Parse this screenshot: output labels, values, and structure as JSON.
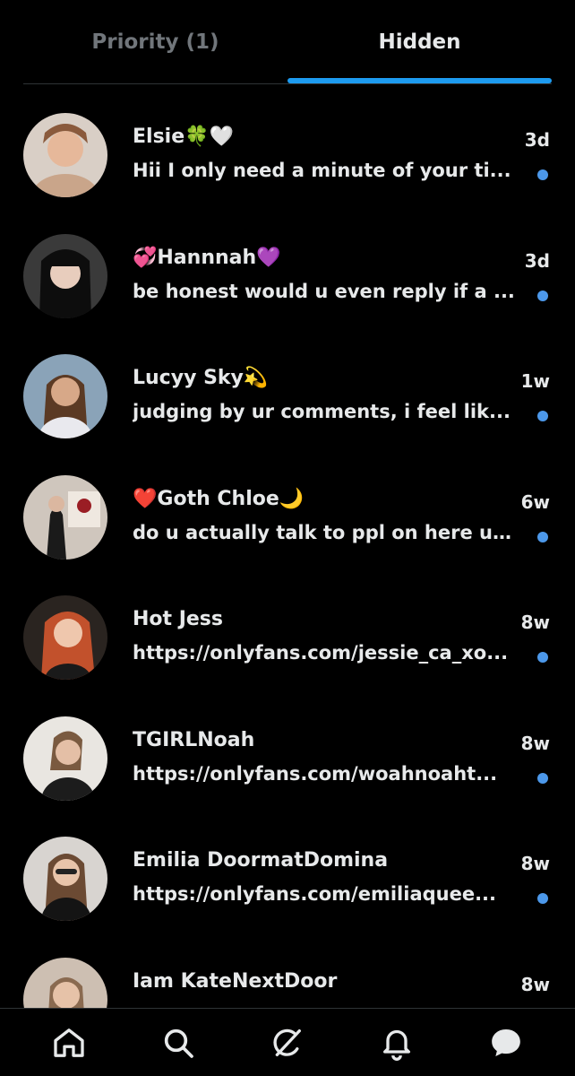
{
  "tabs": [
    {
      "label": "Priority (1)",
      "active": false
    },
    {
      "label": "Hidden",
      "active": true
    }
  ],
  "accent_color": "#1d9bf0",
  "unread_dot_color": "#4c98ea",
  "messages": [
    {
      "name": "Elsie🍀🤍",
      "time": "3d",
      "preview": "Hii I only need a minute of your ti...",
      "unread": true
    },
    {
      "name": "💞Hannnah💜",
      "time": "3d",
      "preview": "be honest would u even reply if a ...",
      "unread": true
    },
    {
      "name": "Lucyy Sky💫",
      "time": "1w",
      "preview": "judging by ur comments, i feel lik...",
      "unread": true
    },
    {
      "name": "❤️Goth Chloe🌙",
      "time": "6w",
      "preview": "do u actually talk to ppl on here ur...",
      "unread": true
    },
    {
      "name": "Hot Jess",
      "time": "8w",
      "preview": "https://onlyfans.com/jessie_ca_xo...",
      "unread": true
    },
    {
      "name": "TGIRLNoah",
      "time": "8w",
      "preview": "https://onlyfans.com/woahnoaht...",
      "unread": true
    },
    {
      "name": "Emilia DoormatDomina",
      "time": "8w",
      "preview": "https://onlyfans.com/emiliaquee...",
      "unread": true
    },
    {
      "name": "Iam KateNextDoor",
      "time": "8w",
      "preview": "",
      "unread": false
    }
  ],
  "bottom_nav": [
    "home-icon",
    "search-icon",
    "grok-icon",
    "notifications-icon",
    "messages-icon"
  ]
}
